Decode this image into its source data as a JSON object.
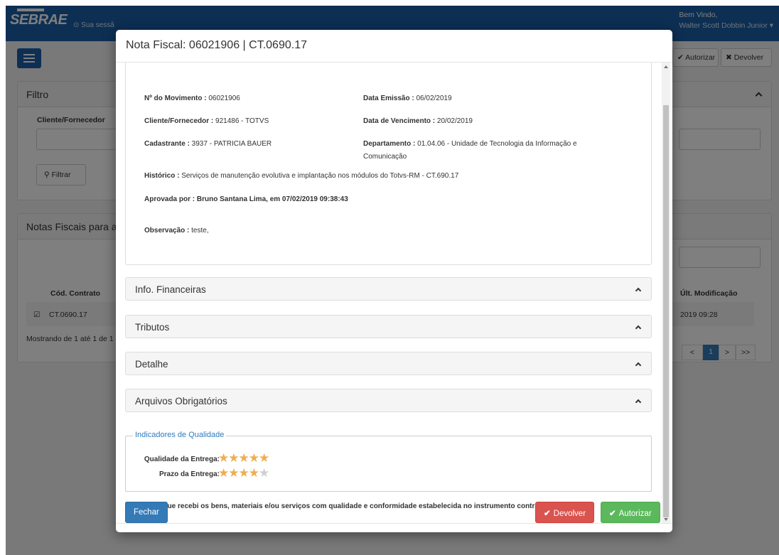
{
  "app": {
    "logo": "SEBRAE",
    "session_text": "⊙ Sua sessã",
    "welcome": "Bem Vindo,",
    "user_name": "Walter Scott Dobbin Junior ▾",
    "toolbar": {
      "autorizar_label": "✔ Autorizar",
      "devolver_label": "✖ Devolver"
    },
    "filtro": {
      "title": "Filtro",
      "cliente_label": "Cliente/Fornecedor",
      "filtrar_label": "Filtrar"
    },
    "notas": {
      "title": "Notas Fiscais para a",
      "col_contrato": "Cód. Contrato",
      "col_modificacao": "Últ. Modificação",
      "row_contrato": "CT.0690.17",
      "row_modificacao": "2019 09:28",
      "showing": "Mostrando de 1 até 1 de 1",
      "pagination": [
        "<",
        "1",
        ">",
        ">>"
      ]
    }
  },
  "modal": {
    "title": "Nota Fiscal: 06021906 | CT.0690.17",
    "fields": {
      "movimento_label": "Nº do Movimento :",
      "movimento_value": " 06021906",
      "emissao_label": "Data Emissão :",
      "emissao_value": " 06/02/2019",
      "cliente_label": "Cliente/Fornecedor :",
      "cliente_value": " 921486 - TOTVS",
      "vencimento_label": "Data de Vencimento :",
      "vencimento_value": " 20/02/2019",
      "cadastrante_label": "Cadastrante :",
      "cadastrante_value": " 3937 - PATRICIA BAUER",
      "departamento_label": "Departamento :",
      "departamento_value": " 01.04.06 - Unidade de Tecnologia da Informação e Comunicação",
      "historico_label": "Histórico :",
      "historico_value": " Serviços de manutenção evolutiva e implantação nos módulos do Totvs-RM - CT.690.17",
      "aprovada": "Aprovada por : Bruno Santana Lima, em 07/02/2019 09:38:43",
      "observacao_label": "Observação :",
      "observacao_value": " teste,"
    },
    "sections": [
      {
        "label": "Info. Financeiras"
      },
      {
        "label": "Tributos"
      },
      {
        "label": "Detalhe"
      },
      {
        "label": "Arquivos Obrigatórios"
      }
    ],
    "quality": {
      "legend": "Indicadores de Qualidade",
      "entrega_label": "Qualidade da Entrega:",
      "entrega_rating": 5,
      "prazo_label": "Prazo da Entrega:",
      "prazo_rating": 4,
      "max_rating": 5
    },
    "declaration": "Declaro que recebi os bens, materiais e/ou serviços com qualidade e conformidade estabelecida no instrumento contratual.",
    "buttons": {
      "fechar": "Fechar",
      "devolver": "Devolver",
      "autorizar": "Autorizar"
    }
  },
  "colors": {
    "brand": "#1a5ea7",
    "primary": "#337ab7",
    "danger": "#d9534f",
    "success": "#5cb85c",
    "star": "#f0ad4e"
  }
}
